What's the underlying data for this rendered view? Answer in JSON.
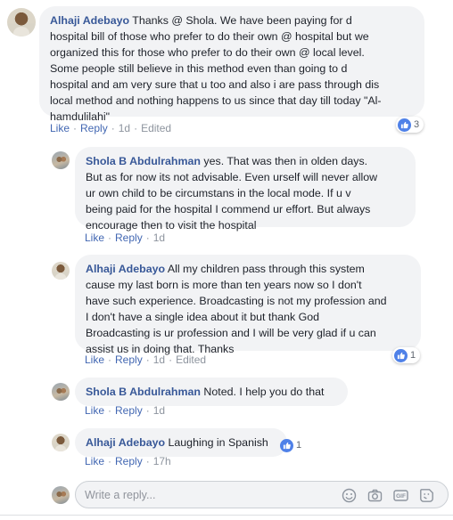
{
  "comments": [
    {
      "author": "Alhaji Adebayo",
      "lines": [
        "Thanks @ Shola. We have been paying for d",
        "hospital bill of those who prefer to do their own @ hospital but we",
        "organized this for those who prefer to do their own @ local level.",
        "Some people still believe in this method even than going to d",
        "hospital and am very sure that u too and also i are pass through dis",
        "local method and nothing happens to us since that day till today \"Al-",
        "hamdulilahi\""
      ],
      "like": "Like",
      "reply": "Reply",
      "time": "1d",
      "edited": "Edited",
      "reactions": "3"
    },
    {
      "author": "Shola B Abdulrahman",
      "lines": [
        "yes. That was then in olden days.",
        "But as for now its not advisable. Even urself will never allow",
        "ur own child to be circumstans in the local mode. If u v",
        "being paid for the hospital I commend ur effort. But always",
        "encourage then to visit the hospital"
      ],
      "like": "Like",
      "reply": "Reply",
      "time": "1d"
    },
    {
      "author": "Alhaji Adebayo",
      "lines": [
        "All my children pass through this system",
        "cause my last born is more than ten years now so I don't",
        "have such experience. Broadcasting is not my profession and",
        "I don't have a single idea about it but thank God",
        "Broadcasting is ur profession and I will be very glad if u can",
        "assist us in doing that. Thanks"
      ],
      "like": "Like",
      "reply": "Reply",
      "time": "1d",
      "edited": "Edited",
      "reactions": "1"
    },
    {
      "author": "Shola B Abdulrahman",
      "lines": [
        "Noted. I help you do that"
      ],
      "like": "Like",
      "reply": "Reply",
      "time": "1d"
    },
    {
      "author": "Alhaji Adebayo",
      "lines": [
        "Laughing in Spanish"
      ],
      "like": "Like",
      "reply": "Reply",
      "time": "17h",
      "reactions": "1"
    }
  ],
  "reply_box": {
    "placeholder": "Write a reply...",
    "tools": [
      "emoji-icon",
      "camera-icon",
      "gif-icon",
      "sticker-icon"
    ]
  },
  "colors": {
    "link": "#4267b2",
    "name": "#385898",
    "bubble": "#f2f3f5",
    "meta": "#8d949e",
    "like_badge": "#4f81e8"
  }
}
